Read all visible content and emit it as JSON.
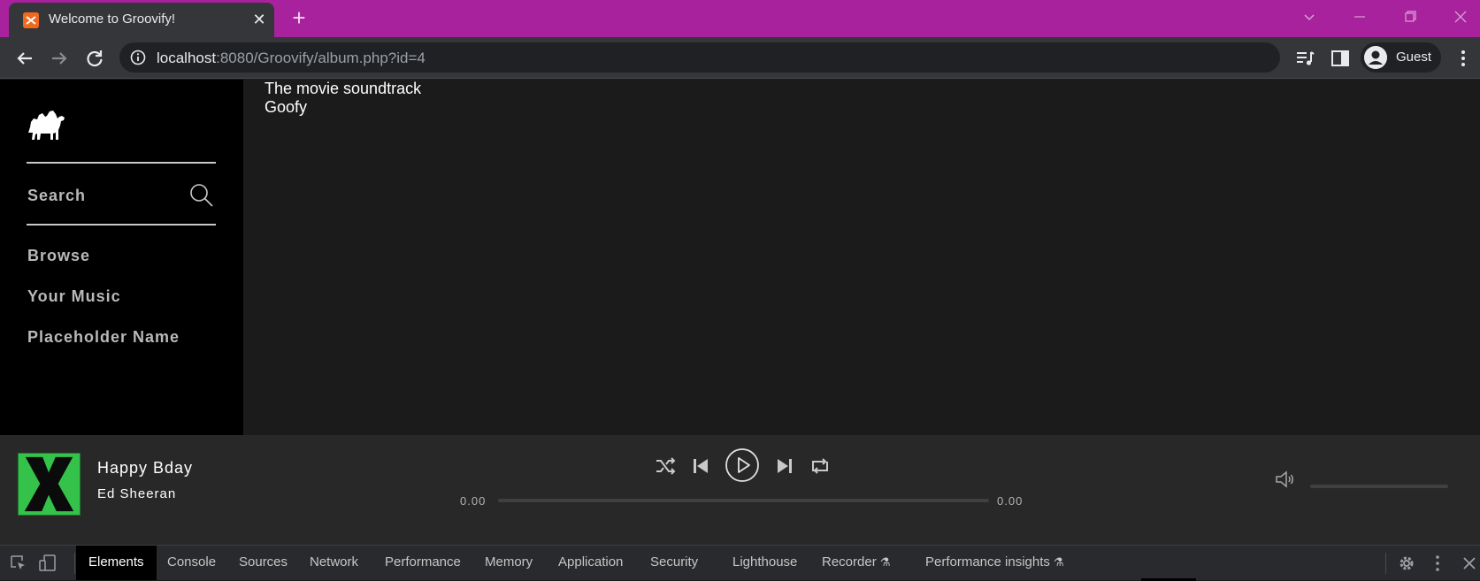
{
  "browser": {
    "tab_title": "Welcome to Groovify!",
    "favicon_text": "ꙮ",
    "url_host": "localhost",
    "url_rest": ":8080/Groovify/album.php?id=4",
    "profile_name": "Guest",
    "new_tab_symbol": "+",
    "tab_close_symbol": "✕"
  },
  "sidebar": {
    "search_label": "Search",
    "items": [
      {
        "label": "Browse"
      },
      {
        "label": "Your Music"
      },
      {
        "label": "Placeholder Name"
      }
    ]
  },
  "album": {
    "title": "The movie soundtrack",
    "artist": "Goofy"
  },
  "player": {
    "track_name": "Happy Bday",
    "track_artist": "Ed Sheeran",
    "time_current": "0.00",
    "time_total": "0.00",
    "progress": 0,
    "volume": 0
  },
  "devtools": {
    "tabs": [
      {
        "label": "Elements"
      },
      {
        "label": "Console"
      },
      {
        "label": "Sources"
      },
      {
        "label": "Network"
      },
      {
        "label": "Performance"
      },
      {
        "label": "Memory"
      },
      {
        "label": "Application"
      },
      {
        "label": "Security"
      },
      {
        "label": "Lighthouse"
      },
      {
        "label": "Recorder"
      },
      {
        "label": "Performance insights"
      }
    ],
    "flask_symbol": "⚗"
  },
  "colors": {
    "titlebar": "#a8229e",
    "accent_green": "#35c24b"
  }
}
